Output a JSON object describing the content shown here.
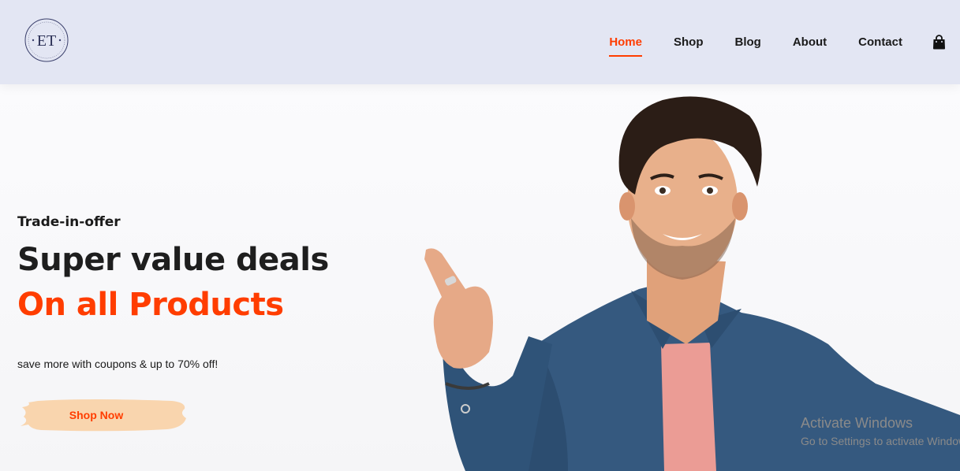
{
  "header": {
    "logo_text": "ET",
    "nav": [
      {
        "label": "Home",
        "active": true
      },
      {
        "label": "Shop",
        "active": false
      },
      {
        "label": "Blog",
        "active": false
      },
      {
        "label": "About",
        "active": false
      },
      {
        "label": "Contact",
        "active": false
      }
    ],
    "cart_icon": "shopping-bag-icon"
  },
  "hero": {
    "eyebrow": "Trade-in-offer",
    "headline": "Super value deals",
    "headline_accent": "On all Products",
    "subtext": "save more with coupons & up to 70% off!",
    "cta_label": "Shop Now"
  },
  "watermark": {
    "title": "Activate Windows",
    "subtitle": "Go to Settings to activate Windows."
  },
  "colors": {
    "accent": "#ff3d00",
    "header_bg": "#e3e6f3",
    "cta_bg": "#f9d5ae",
    "shirt": "#35597f"
  }
}
